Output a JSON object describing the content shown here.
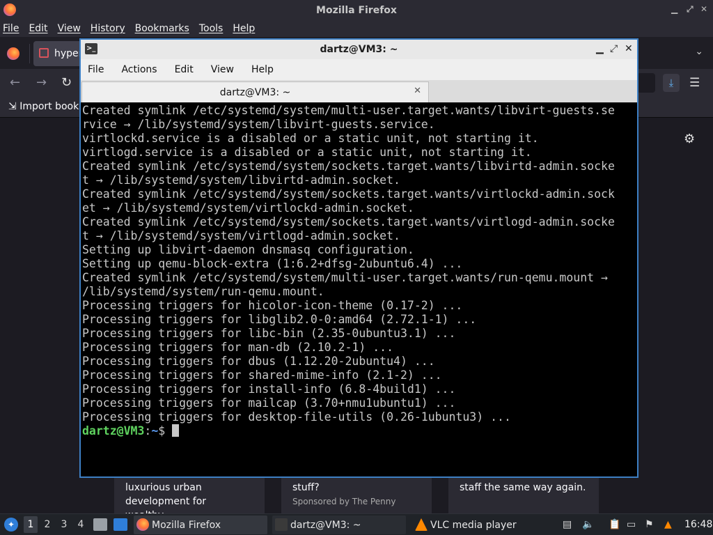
{
  "firefox": {
    "window_title": "Mozilla Firefox",
    "menu": [
      "File",
      "Edit",
      "View",
      "History",
      "Bookmarks",
      "Tools",
      "Help"
    ],
    "tab_title": "hyper",
    "bookmarks_item": "Import book",
    "cards": [
      {
        "lines": [
          "luxurious urban",
          "development for wealthy…"
        ]
      },
      {
        "lines": [
          "stuff?",
          "Sponsored by The Penny"
        ]
      },
      {
        "lines": [
          "staff the same way again."
        ]
      }
    ]
  },
  "terminal": {
    "window_title": "dartz@VM3: ~",
    "menu": [
      "File",
      "Actions",
      "Edit",
      "View",
      "Help"
    ],
    "tab_title": "dartz@VM3: ~",
    "output_lines": [
      "Created symlink /etc/systemd/system/multi-user.target.wants/libvirt-guests.se",
      "rvice → /lib/systemd/system/libvirt-guests.service.",
      "virtlockd.service is a disabled or a static unit, not starting it.",
      "virtlogd.service is a disabled or a static unit, not starting it.",
      "Created symlink /etc/systemd/system/sockets.target.wants/libvirtd-admin.socke",
      "t → /lib/systemd/system/libvirtd-admin.socket.",
      "Created symlink /etc/systemd/system/sockets.target.wants/virtlockd-admin.sock",
      "et → /lib/systemd/system/virtlockd-admin.socket.",
      "Created symlink /etc/systemd/system/sockets.target.wants/virtlogd-admin.socke",
      "t → /lib/systemd/system/virtlogd-admin.socket.",
      "Setting up libvirt-daemon dnsmasq configuration.",
      "Setting up qemu-block-extra (1:6.2+dfsg-2ubuntu6.4) ...",
      "Created symlink /etc/systemd/system/multi-user.target.wants/run-qemu.mount →",
      "/lib/systemd/system/run-qemu.mount.",
      "Processing triggers for hicolor-icon-theme (0.17-2) ...",
      "Processing triggers for libglib2.0-0:amd64 (2.72.1-1) ...",
      "Processing triggers for libc-bin (2.35-0ubuntu3.1) ...",
      "Processing triggers for man-db (2.10.2-1) ...",
      "Processing triggers for dbus (1.12.20-2ubuntu4) ...",
      "Processing triggers for shared-mime-info (2.1-2) ...",
      "Processing triggers for install-info (6.8-4build1) ...",
      "Processing triggers for mailcap (3.70+nmu1ubuntu1) ...",
      "Processing triggers for desktop-file-utils (0.26-1ubuntu3) ..."
    ],
    "prompt": {
      "user": "dartz@VM3",
      "sep": ":",
      "path": "~",
      "symbol": "$ "
    }
  },
  "taskbar": {
    "workspaces": [
      "1",
      "2",
      "3",
      "4"
    ],
    "tasks": [
      {
        "label": "Mozilla Firefox",
        "icon": "firefox-icon"
      },
      {
        "label": "dartz@VM3: ~",
        "icon": "terminal-icon"
      },
      {
        "label": "VLC media player",
        "icon": "vlc-icon"
      }
    ],
    "clock": "16:48"
  },
  "colors": {
    "accent": "#3d7fc4",
    "prompt_user": "#5fd35f",
    "prompt_path": "#5c9cf4"
  }
}
